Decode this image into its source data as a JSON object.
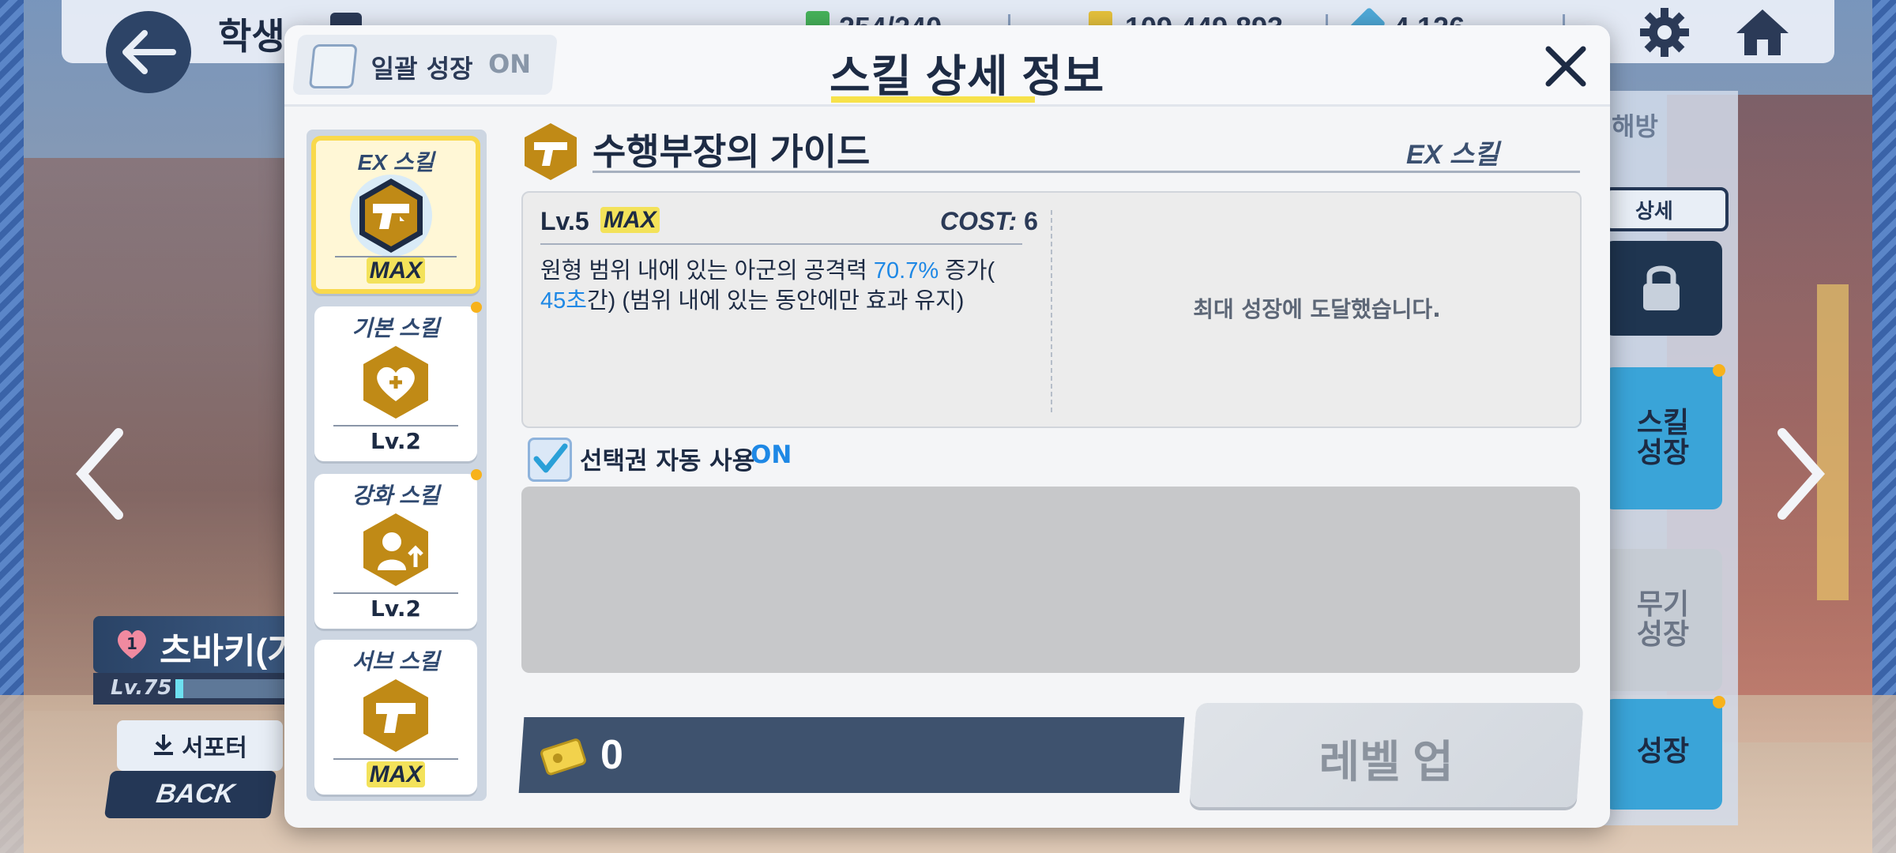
{
  "topbar": {
    "title": "학생",
    "resources": [
      {
        "name": "ap",
        "value": "254/240",
        "icon": "ap-icon"
      },
      {
        "name": "credits",
        "value": "109,449,893",
        "icon": "credit-icon"
      },
      {
        "name": "pyroxene",
        "value": "4,126",
        "icon": "pyroxene-icon"
      }
    ]
  },
  "character": {
    "affection": "1",
    "name": "츠바키(가이드)",
    "level": "Lv.75",
    "supporter_label": "서포터",
    "back_label": "BACK"
  },
  "right_panel": {
    "header": "해방",
    "detail_label": "상세",
    "locked_label": "능력개방",
    "skill_growth": "스킬\n성장",
    "weapon_growth": "무기\n성장",
    "growth": "성장"
  },
  "modal": {
    "title": "스킬 상세 정보",
    "bulk_growth_label": "일괄 성장",
    "bulk_growth_state": "ON"
  },
  "tabs": [
    {
      "category": "EX 스킬",
      "level": "MAX",
      "active": true,
      "icon": "gun-icon"
    },
    {
      "category": "기본 스킬",
      "level": "Lv.2",
      "active": false,
      "icon": "heal-icon"
    },
    {
      "category": "강화 스킬",
      "level": "Lv.2",
      "active": false,
      "icon": "buff-icon"
    },
    {
      "category": "서브 스킬",
      "level": "MAX",
      "active": false,
      "icon": "gun-icon"
    }
  ],
  "skill": {
    "name": "수행부장의 가이드",
    "type": "EX 스킬",
    "level": "Lv.5",
    "level_max": "MAX",
    "cost_label": "COST",
    "cost_value": "6",
    "desc_part1": "원형 범위 내에 있는 아군의 공격력 ",
    "desc_hl1": "70.7%",
    "desc_part2": " 증가(",
    "desc_hl2": "45초",
    "desc_part3": "간) (범위 내에 있는 동안에만 효과 유지)",
    "max_message": "최대 성장에 도달했습니다."
  },
  "auto_use": {
    "label": "선택권 자동 사용",
    "state": "ON"
  },
  "cost_bar": {
    "value": "0"
  },
  "level_up_button": "레벨 업",
  "colors": {
    "accent_yellow": "#f7e24a",
    "highlight_blue": "#1e88e5",
    "navy": "#1d2b44"
  }
}
